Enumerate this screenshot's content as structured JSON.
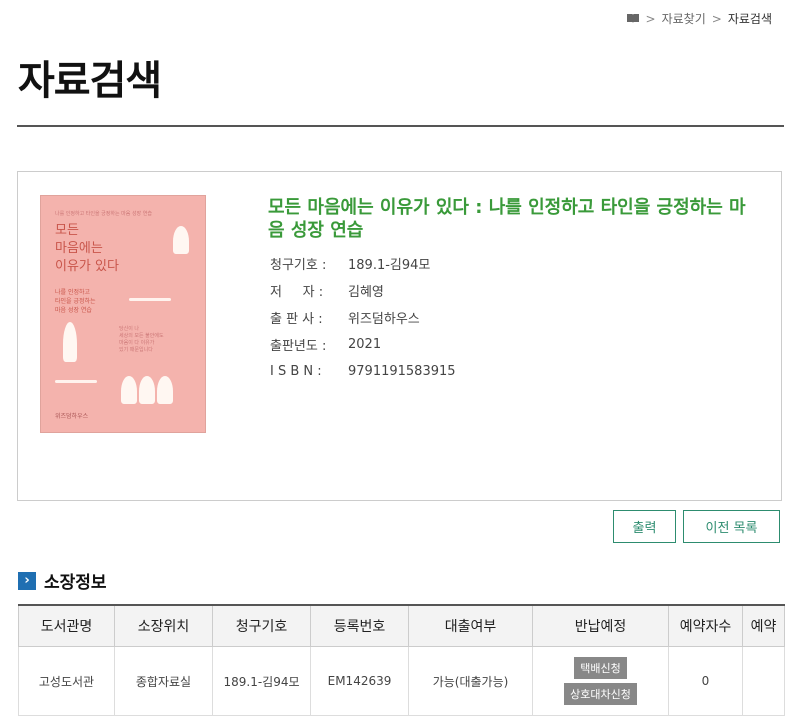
{
  "breadcrumb": {
    "items": [
      "자료찾기",
      "자료검색"
    ]
  },
  "page_title": "자료검색",
  "book": {
    "title": "모든 마음에는 이유가 있다 : 나를 인정하고 타인을 긍정하는 마음 성장 연습",
    "cover": {
      "top_text": "나를 인정하고 타인을 긍정하는 마음 성장 연습",
      "title_line1": "모든",
      "title_line2": "마음에는",
      "title_line3": "이유가 있다",
      "subtitle": "나를 인정하고\n타인을 긍정하는\n마음 성장 연습",
      "body": "당신이 나\n세상의 모든 불안에도\n마음이 다 이유가\n있기 때문입니다",
      "publisher": "위즈덤하우스"
    },
    "meta": [
      {
        "label": "청구기호 :",
        "value": "189.1-김94모"
      },
      {
        "label": "저     자 :",
        "value": "김혜영"
      },
      {
        "label": "출 판 사 :",
        "value": "위즈덤하우스"
      },
      {
        "label": "출판년도 :",
        "value": "2021"
      },
      {
        "label": "I S B N :",
        "value": "9791191583915"
      }
    ]
  },
  "buttons": {
    "print": "출력",
    "back": "이전 목록"
  },
  "holdings": {
    "section_title": "소장정보",
    "section_icon": "chevron-right-icon",
    "columns": [
      "도서관명",
      "소장위치",
      "청구기호",
      "등록번호",
      "대출여부",
      "반납예정",
      "예약자수",
      "예약"
    ],
    "rows": [
      {
        "library": "고성도서관",
        "location": "종합자료실",
        "call_number": "189.1-김94모",
        "reg_number": "EM142639",
        "loan_status": "가능(대출가능)",
        "actions": [
          "택배신청",
          "상호대차신청"
        ],
        "reservations": "0",
        "reserve": ""
      }
    ]
  },
  "colors": {
    "title_green": "#3a9a3a",
    "button_green": "#2d8c6f",
    "section_blue": "#1f6fb2"
  }
}
